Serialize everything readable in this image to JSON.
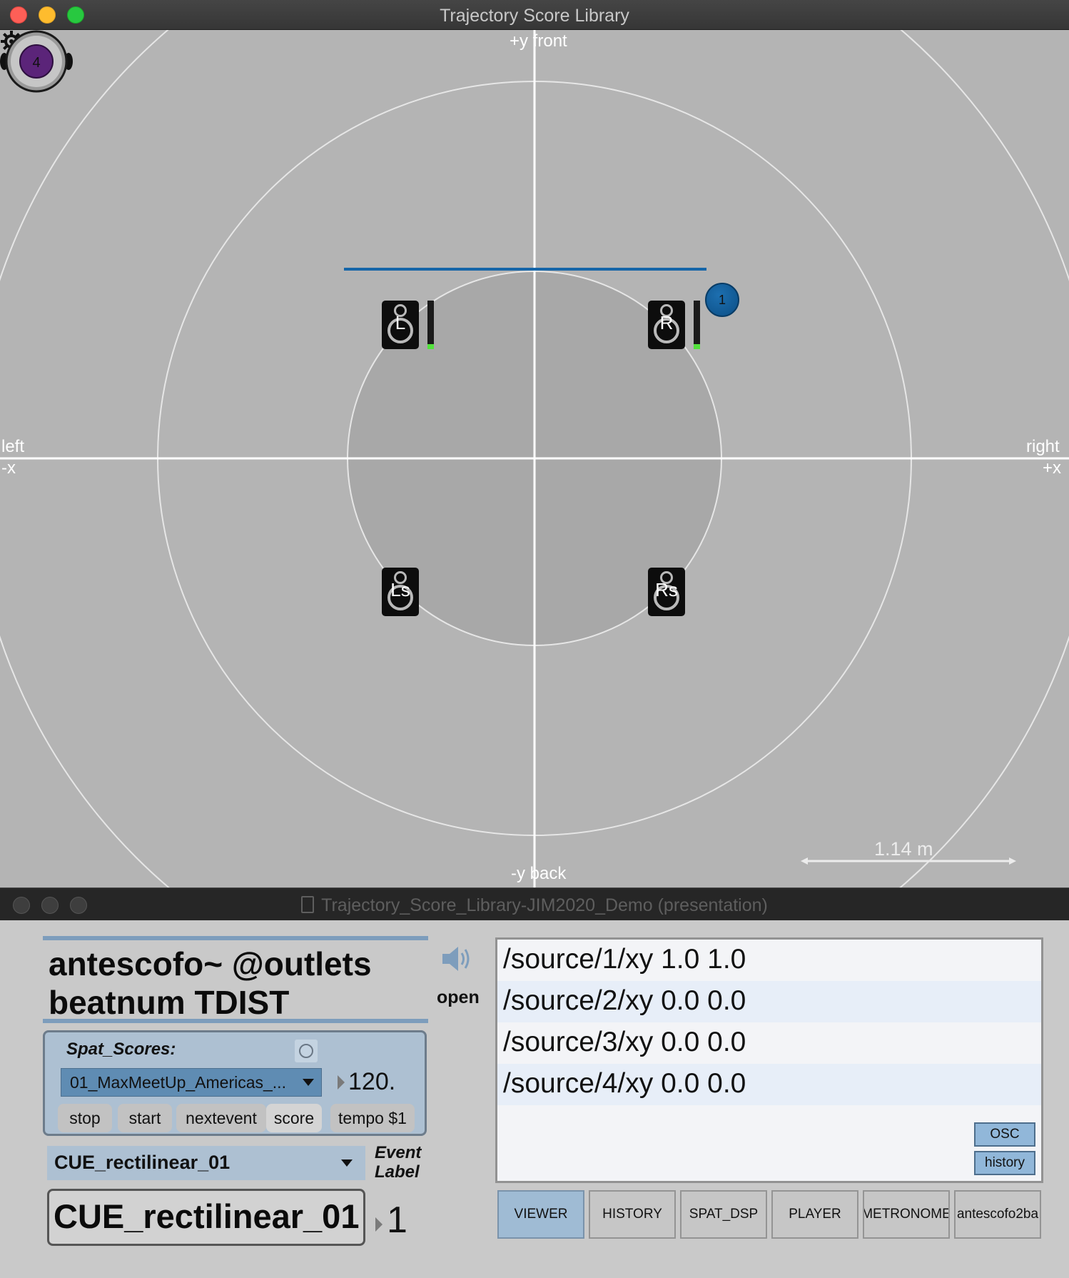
{
  "window1": {
    "title": "Trajectory Score Library"
  },
  "viewer": {
    "labels": {
      "top": "+y front",
      "bottom": "-y back",
      "left": "left",
      "left_axis": "-x",
      "right": "right",
      "right_axis": "+x"
    },
    "scale_text": "1.14 m",
    "sources": [
      {
        "id": "1",
        "color": "#1565a8"
      },
      {
        "id": "4",
        "color": "#5b2479"
      }
    ],
    "speakers": [
      "L",
      "R",
      "Ls",
      "Rs"
    ],
    "icons": {
      "settings": "gear-icon"
    }
  },
  "window2": {
    "title": "Trajectory_Score_Library-JIM2020_Demo (presentation)"
  },
  "patch": {
    "comment_line1": "antescofo~ @outlets",
    "comment_line2": "beatnum TDIST",
    "open_label": "open",
    "spat_scores_title": "Spat_Scores:",
    "score_menu_value": "01_MaxMeetUp_Americas_...",
    "tempo_value": "120.",
    "buttons": {
      "stop": "stop",
      "start": "start",
      "nextevent": "nextevent",
      "score": "score",
      "tempo": "tempo $1"
    },
    "cue_menu_value": "CUE_rectilinear_01",
    "event_label_line1": "Event",
    "event_label_line2": "Label",
    "cue_message": "CUE_rectilinear_01",
    "event_number": "1"
  },
  "osc_list": {
    "rows": [
      "/source/1/xy 1.0 1.0",
      "/source/2/xy 0.0 0.0",
      "/source/3/xy 0.0 0.0",
      "/source/4/xy 0.0 0.0"
    ],
    "osc_button": "OSC",
    "history_button": "history"
  },
  "tabs": [
    "VIEWER",
    "HISTORY",
    "SPAT_DSP",
    "PLAYER",
    "METRONOME",
    "antescofo2ba"
  ],
  "colors": {
    "accent_blue": "#9fbbd4",
    "panel_blue": "#adc0d2",
    "menu_blue": "#5f8cb3",
    "meter_green": "#52e23b"
  }
}
